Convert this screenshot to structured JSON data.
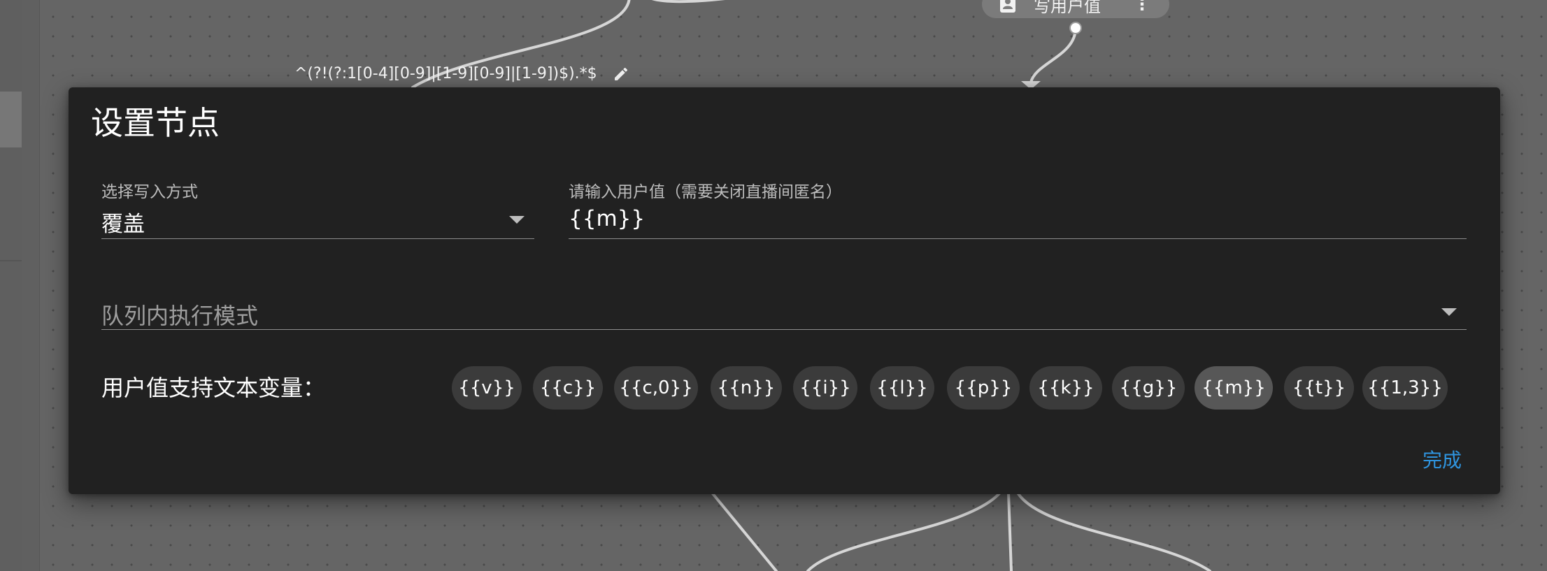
{
  "canvas": {
    "edge_label": "^(?!(?:1[0-4][0-9]|[1-9][0-9]|[1-9])$).*$",
    "node": {
      "label": "写用户值",
      "icon": "contact-card-icon",
      "more_icon": "more-vert-icon"
    }
  },
  "dialog": {
    "title": "设置节点",
    "write_mode": {
      "label": "选择写入方式",
      "value": "覆盖"
    },
    "user_value": {
      "label": "请输入用户值（需要关闭直播间匿名）",
      "value": "{{m}}"
    },
    "queue_mode": {
      "placeholder": "队列内执行模式"
    },
    "variables": {
      "label": "用户值支持文本变量：",
      "chips": [
        "{{v}}",
        "{{c}}",
        "{{c,0}}",
        "{{n}}",
        "{{i}}",
        "{{l}}",
        "{{p}}",
        "{{k}}",
        "{{g}}",
        "{{m}}",
        "{{t}}",
        "{{1,3}}"
      ],
      "active": "{{m}}"
    },
    "done_label": "完成"
  },
  "colors": {
    "accent": "#2f95e0",
    "dialog_bg": "#212121",
    "canvas_bg": "#656565",
    "chip_bg": "#3b3b3b",
    "chip_active_bg": "#575757"
  }
}
